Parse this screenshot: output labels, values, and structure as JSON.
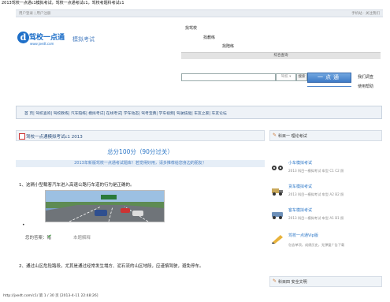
{
  "browser": {
    "title": "2013驾校一点通c1模拟考试，驾校一点通考试c1，驾校考题科考试c1"
  },
  "topbar": {
    "left": "用户登录 | 用户注册",
    "right": "手机站 · 关注我们"
  },
  "logo": {
    "main": "驾校一点通",
    "url": "www.jxedt.com",
    "site_name": "模拟考试"
  },
  "nav": {
    "link1": "找驾校",
    "link2": "找教练",
    "link3": "找陪练",
    "bar": "综合查询"
  },
  "search": {
    "input_placeholder": "",
    "select": "驾校  ▾",
    "small_btn": "搜索",
    "button": "一点通",
    "hot1": "我们调查",
    "hot2": "使用帮助"
  },
  "catbar": {
    "text": "首    页| 驾校查询| 驾校教练| 汽车陪练| 模拟考试| 在线考试| 学车动态| 驾考宝典| 学车视频| 驾驶技能| 车友之家| 车友论坛"
  },
  "main": {
    "title": "驾校一点通模拟考试c1 2013",
    "score": "总分100分（90分过关）",
    "promo": "2013年新版驾校一点通考试题库！若觉得好用，请多推荐给您身边的朋友！",
    "q1": "1、这辆小型载客汽车进入高速公路行车道的行为是正确的。",
    "q1_bullet": "•",
    "answer_label": "您的答案：错",
    "answer_check_icon": "check-icon",
    "explain_link": "本题解释",
    "q2": "2、通过山区危险路段，尤其是通过经常发生塌方、泥石流的山区地段，应谨慎驾驶，避免停车。"
  },
  "sidebar": {
    "head1": "科目一  理论考试",
    "items": [
      {
        "title": "小车模拟考试",
        "desc": "2013 科目一模拟考试 车型 C1 C2 照"
      },
      {
        "title": "货车模拟考试",
        "desc": "2013 科目一模拟考试 车型 A2 B2 照"
      },
      {
        "title": "客车模拟考试",
        "desc": "2013 科目一模拟考试 车型 A1 B1 照"
      },
      {
        "title": "驾校一点通Vip版",
        "desc": "包含单项，成绩历史，无弹窗广告下载"
      }
    ],
    "head2": "科目四  安全文明"
  },
  "footer": {
    "text": "http://jxedt.com/c1/  第 1 / 30 页  [2013-4-11 22:48:26]"
  },
  "colors": {
    "brand": "#1e6fc8",
    "accent": "#2e78c7",
    "bar": "#eef2f7"
  }
}
